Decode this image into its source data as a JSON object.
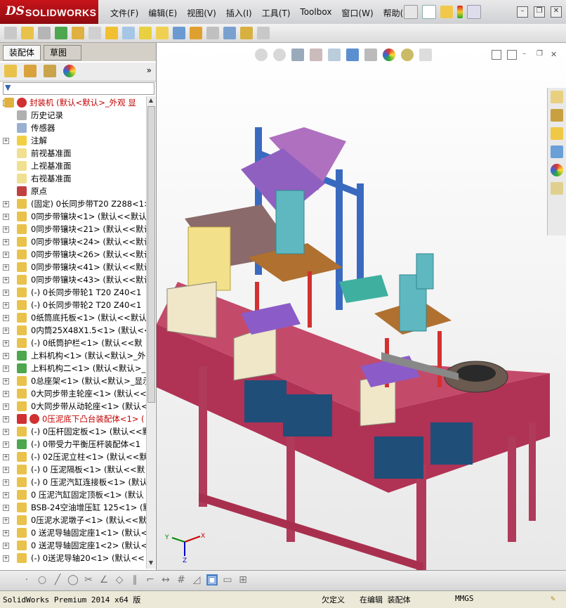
{
  "app": {
    "logo_prefix": "DS",
    "logo_text": "SOLIDWORKS",
    "menu": [
      "文件(F)",
      "编辑(E)",
      "视图(V)",
      "插入(I)",
      "工具(T)",
      "Toolbox",
      "窗口(W)",
      "帮助(H)"
    ]
  },
  "panel": {
    "tabs": [
      "装配体",
      "草图"
    ],
    "tree": [
      {
        "label": "封装机  (默认<默认>_外观 显",
        "icon": "assembly-icon",
        "red": true,
        "expander": "-"
      },
      {
        "label": "历史记录",
        "icon": "history-icon",
        "expander": ""
      },
      {
        "label": "传感器",
        "icon": "sensor-icon",
        "expander": ""
      },
      {
        "label": "注解",
        "icon": "annotation-icon",
        "expander": "+"
      },
      {
        "label": "前视基准面",
        "icon": "plane-icon",
        "expander": ""
      },
      {
        "label": "上视基准面",
        "icon": "plane-icon",
        "expander": ""
      },
      {
        "label": "右视基准面",
        "icon": "plane-icon",
        "expander": ""
      },
      {
        "label": "原点",
        "icon": "origin-icon",
        "expander": ""
      },
      {
        "label": "(固定) 0长同步带T20 Z288<1>",
        "icon": "part-icon",
        "expander": "+"
      },
      {
        "label": "0同步带镶块<1> (默认<<默认",
        "icon": "part-icon",
        "expander": "+"
      },
      {
        "label": "0同步带镶块<21> (默认<<默认",
        "icon": "part-icon",
        "expander": "+"
      },
      {
        "label": "0同步带镶块<24> (默认<<默认",
        "icon": "part-icon",
        "expander": "+"
      },
      {
        "label": "0同步带镶块<26> (默认<<默认",
        "icon": "part-icon",
        "expander": "+"
      },
      {
        "label": "0同步带镶块<41> (默认<<默认",
        "icon": "part-icon",
        "expander": "+"
      },
      {
        "label": "0同步带镶块<43> (默认<<默认",
        "icon": "part-icon",
        "expander": "+"
      },
      {
        "label": "(-) 0长同步带轮1 T20 Z40<1",
        "icon": "part-icon",
        "expander": "+"
      },
      {
        "label": "(-) 0长同步带轮2 T20 Z40<1",
        "icon": "part-icon",
        "expander": "+"
      },
      {
        "label": "0纸筒底托板<1> (默认<<默认",
        "icon": "part-icon",
        "expander": "+"
      },
      {
        "label": "0内筒25X48X1.5<1> (默认<<默",
        "icon": "part-icon",
        "expander": "+"
      },
      {
        "label": "(-) 0纸筒护栏<1> (默认<<默",
        "icon": "part-icon",
        "expander": "+"
      },
      {
        "label": "上料机构<1> (默认<默认>_外",
        "icon": "subassembly-icon",
        "expander": "+"
      },
      {
        "label": "上料机构二<1> (默认<默认>_",
        "icon": "subassembly-icon",
        "expander": "+"
      },
      {
        "label": "0总座架<1> (默认<默认>_显示",
        "icon": "part-icon",
        "expander": "+"
      },
      {
        "label": "0大同步带主轮座<1> (默认<<默",
        "icon": "part-icon",
        "expander": "+"
      },
      {
        "label": "0大同步带从动轮座<1> (默认<<",
        "icon": "part-icon",
        "expander": "+"
      },
      {
        "label": "0压泥底下凸台装配体<1> (",
        "icon": "error-subassembly-icon",
        "red": true,
        "expander": "+"
      },
      {
        "label": "(-) 0压杆固定板<1> (默认<<默",
        "icon": "part-icon",
        "expander": "+"
      },
      {
        "label": "(-) 0带受力平衡压杆装配体<1",
        "icon": "subassembly-icon",
        "expander": "+"
      },
      {
        "label": "(-) 02压泥立柱<1> (默认<<默",
        "icon": "part-icon",
        "expander": "+"
      },
      {
        "label": "(-) 0 压泥隔板<1> (默认<<默",
        "icon": "part-icon",
        "expander": "+"
      },
      {
        "label": "(-) 0 压泥汽缸连接板<1> (默认",
        "icon": "part-icon",
        "expander": "+"
      },
      {
        "label": "0 压泥汽缸固定顶板<1> (默认",
        "icon": "part-icon",
        "expander": "+"
      },
      {
        "label": "BSB-24空油增压缸 125<1> (默",
        "icon": "part-icon",
        "expander": "+"
      },
      {
        "label": "0压泥水泥墩子<1> (默认<<默认",
        "icon": "part-icon",
        "expander": "+"
      },
      {
        "label": "0 送泥导轴固定座1<1> (默认<",
        "icon": "part-icon",
        "expander": "+"
      },
      {
        "label": "0 送泥导轴固定座1<2> (默认<",
        "icon": "part-icon",
        "expander": "+"
      },
      {
        "label": "(-) 0送泥导轴20<1> (默认<<",
        "icon": "part-icon",
        "expander": "+"
      }
    ]
  },
  "viewport": {
    "triad_labels": {
      "x": "X",
      "y": "Y",
      "z": "Z"
    }
  },
  "status": {
    "product": "SolidWorks Premium 2014 x64 版",
    "defined": "欠定义",
    "mode": "在编辑 装配体",
    "units": "MMGS"
  }
}
